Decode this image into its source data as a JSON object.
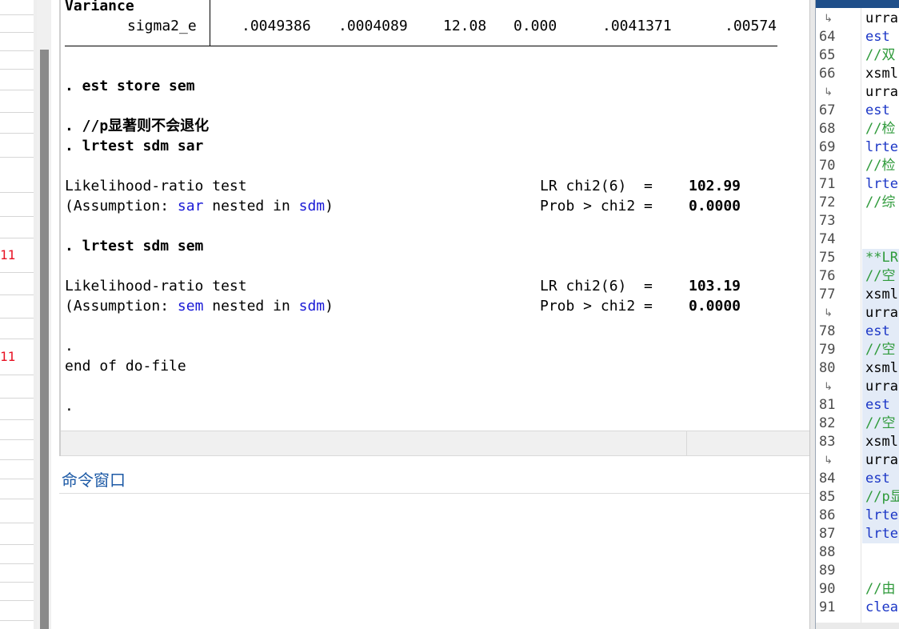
{
  "left_panel": {
    "row_labels": [
      "11",
      "11"
    ]
  },
  "results": {
    "variance_header": "Variance",
    "sigma_row": {
      "label": "sigma2_e",
      "coef": ".0049386",
      "se": ".0004089",
      "z": "12.08",
      "p": "0.000",
      "ci_low": ".0041371",
      "ci_high": ".00574"
    },
    "cmd_est_store": ". est store sem",
    "cmd_comment": ". //p显著则不会退化",
    "cmd_lrtest1": ". lrtest sdm sar",
    "lr1": {
      "title": "Likelihood-ratio test",
      "assump_prefix": "(Assumption: ",
      "assump_model": "sar",
      "assump_mid": " nested in ",
      "assump_full": "sdm",
      "assump_suffix": ")",
      "chi2_label": "LR chi2(6)  =",
      "chi2_value": "102.99",
      "prob_label": "Prob > chi2 =",
      "prob_value": "0.0000"
    },
    "cmd_lrtest2": ". lrtest sdm sem",
    "lr2": {
      "title": "Likelihood-ratio test",
      "assump_prefix": "(Assumption: ",
      "assump_model": "sem",
      "assump_mid": " nested in ",
      "assump_full": "sdm",
      "assump_suffix": ")",
      "chi2_label": "LR chi2(6)  =",
      "chi2_value": "103.19",
      "prob_label": "Prob > chi2 =",
      "prob_value": "0.0000"
    },
    "dot1": ".",
    "end_text": "end of do-file",
    "dot2": "."
  },
  "command_window": {
    "title": "命令窗口"
  },
  "editor": {
    "lines": [
      {
        "num": "",
        "wrap": true,
        "code": "urra",
        "style": "c-black",
        "hl": false
      },
      {
        "num": "64",
        "wrap": false,
        "code": "est",
        "style": "c-blue",
        "hl": false
      },
      {
        "num": "65",
        "wrap": false,
        "code": "//双",
        "style": "c-green",
        "hl": false
      },
      {
        "num": "66",
        "wrap": false,
        "code": "xsml",
        "style": "c-black",
        "hl": false
      },
      {
        "num": "",
        "wrap": true,
        "code": "urra",
        "style": "c-black",
        "hl": false
      },
      {
        "num": "67",
        "wrap": false,
        "code": "est",
        "style": "c-blue",
        "hl": false
      },
      {
        "num": "68",
        "wrap": false,
        "code": "//检",
        "style": "c-green",
        "hl": false
      },
      {
        "num": "69",
        "wrap": false,
        "code": "lrte",
        "style": "c-blue",
        "hl": false
      },
      {
        "num": "70",
        "wrap": false,
        "code": "//检",
        "style": "c-green",
        "hl": false
      },
      {
        "num": "71",
        "wrap": false,
        "code": "lrte",
        "style": "c-blue",
        "hl": false
      },
      {
        "num": "72",
        "wrap": false,
        "code": "//综",
        "style": "c-green",
        "hl": false
      },
      {
        "num": "73",
        "wrap": false,
        "code": "",
        "style": "c-black",
        "hl": false
      },
      {
        "num": "74",
        "wrap": false,
        "code": "",
        "style": "c-black",
        "hl": false
      },
      {
        "num": "75",
        "wrap": false,
        "code": "**LR",
        "style": "c-green",
        "hl": true
      },
      {
        "num": "76",
        "wrap": false,
        "code": "//空",
        "style": "c-green",
        "hl": true
      },
      {
        "num": "77",
        "wrap": false,
        "code": "xsml",
        "style": "c-black",
        "hl": true
      },
      {
        "num": "",
        "wrap": true,
        "code": "urra",
        "style": "c-black",
        "hl": true
      },
      {
        "num": "78",
        "wrap": false,
        "code": "est",
        "style": "c-blue",
        "hl": true
      },
      {
        "num": "79",
        "wrap": false,
        "code": "//空",
        "style": "c-green",
        "hl": true
      },
      {
        "num": "80",
        "wrap": false,
        "code": "xsml",
        "style": "c-black",
        "hl": true
      },
      {
        "num": "",
        "wrap": true,
        "code": "urra",
        "style": "c-black",
        "hl": true
      },
      {
        "num": "81",
        "wrap": false,
        "code": "est",
        "style": "c-blue",
        "hl": true
      },
      {
        "num": "82",
        "wrap": false,
        "code": "//空",
        "style": "c-green",
        "hl": true
      },
      {
        "num": "83",
        "wrap": false,
        "code": "xsml",
        "style": "c-black",
        "hl": true
      },
      {
        "num": "",
        "wrap": true,
        "code": "urra",
        "style": "c-black",
        "hl": true
      },
      {
        "num": "84",
        "wrap": false,
        "code": "est",
        "style": "c-blue",
        "hl": true
      },
      {
        "num": "85",
        "wrap": false,
        "code": "//p显",
        "style": "c-green",
        "hl": true
      },
      {
        "num": "86",
        "wrap": false,
        "code": "lrte",
        "style": "c-blue",
        "hl": true
      },
      {
        "num": "87",
        "wrap": false,
        "code": "lrte",
        "style": "c-blue",
        "hl": true
      },
      {
        "num": "88",
        "wrap": false,
        "code": "",
        "style": "c-black",
        "hl": false
      },
      {
        "num": "89",
        "wrap": false,
        "code": "",
        "style": "c-black",
        "hl": false
      },
      {
        "num": "90",
        "wrap": false,
        "code": "//由",
        "style": "c-green",
        "hl": false
      },
      {
        "num": "91",
        "wrap": false,
        "code": "clea",
        "style": "c-blue",
        "hl": false
      }
    ]
  }
}
